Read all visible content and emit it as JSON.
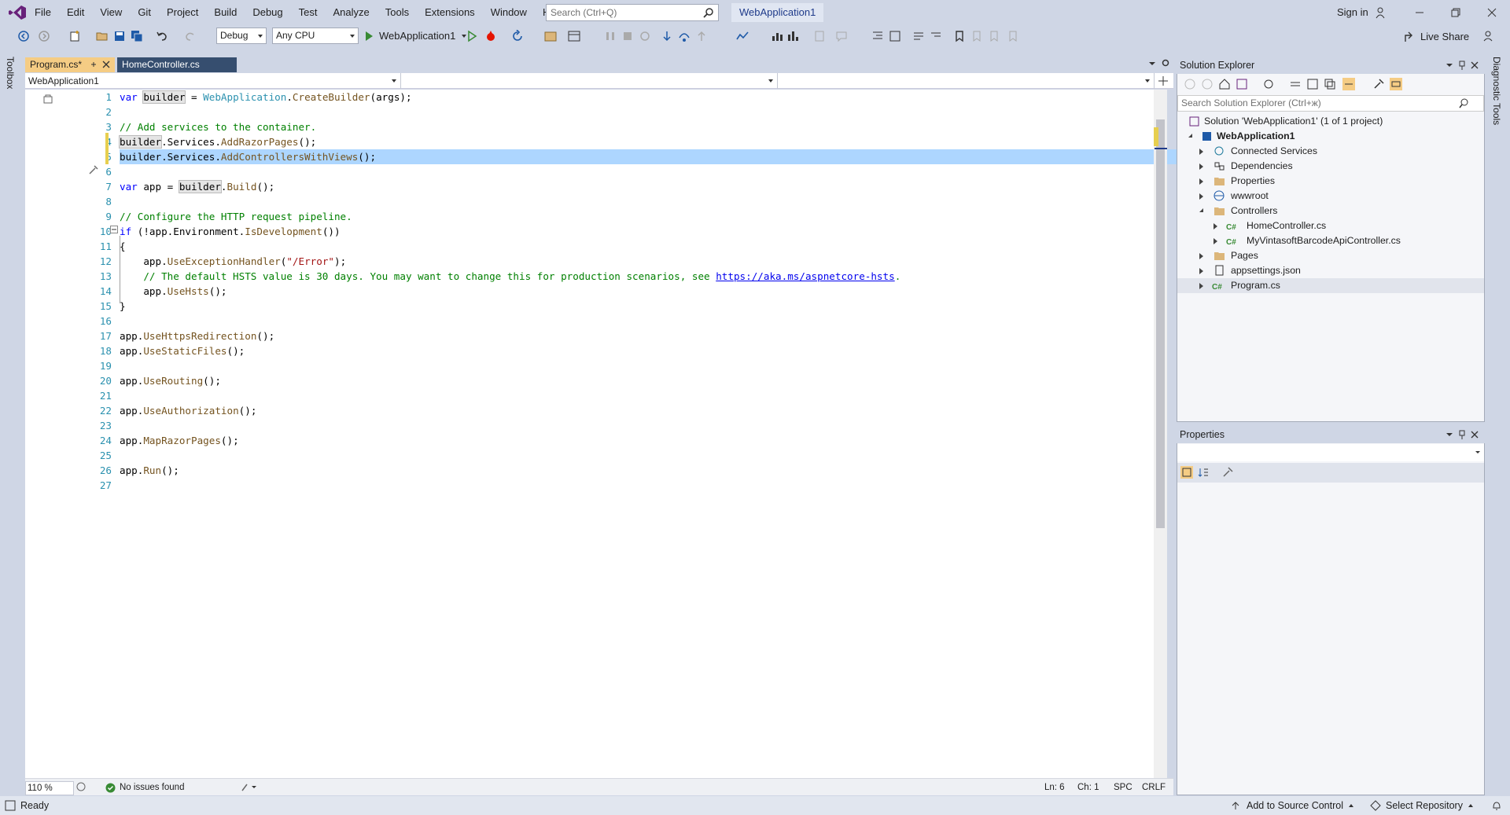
{
  "menu": {
    "items": [
      "File",
      "Edit",
      "View",
      "Git",
      "Project",
      "Build",
      "Debug",
      "Test",
      "Analyze",
      "Tools",
      "Extensions",
      "Window",
      "Help"
    ],
    "search_placeholder": "Search (Ctrl+Q)",
    "solution_name": "WebApplication1",
    "sign_in": "Sign in"
  },
  "toolbar": {
    "config": "Debug",
    "platform": "Any CPU",
    "run_target": "WebApplication1",
    "live_share": "Live Share"
  },
  "left_rail": {
    "toolbox": "Toolbox"
  },
  "right_rail": {
    "diagnostic_tools": "Diagnostic Tools"
  },
  "tabs": [
    {
      "label": "Program.cs*",
      "active": true
    },
    {
      "label": "HomeController.cs",
      "active": false
    }
  ],
  "navbar": {
    "project": "WebApplication1",
    "type": "",
    "member": ""
  },
  "code_lines": [
    "1",
    "2",
    "3",
    "4",
    "5",
    "6",
    "7",
    "8",
    "9",
    "10",
    "11",
    "12",
    "13",
    "14",
    "15",
    "16",
    "17",
    "18",
    "19",
    "20",
    "21",
    "22",
    "23",
    "24",
    "25",
    "26",
    "27"
  ],
  "code": {
    "l1_a": "var ",
    "l1_b": "builder",
    "l1_c": " = ",
    "l1_d": "WebApplication",
    "l1_e": ".",
    "l1_f": "CreateBuilder",
    "l1_g": "(args);",
    "l3": "// Add services to the container.",
    "l4_a": "builder",
    "l4_b": ".Services.",
    "l4_c": "AddRazorPages",
    "l4_d": "();",
    "l5_a": "builder",
    "l5_b": ".Services.",
    "l5_c": "AddControllersWithViews",
    "l5_d": "();",
    "l7_a": "var ",
    "l7_b": "app = ",
    "l7_c": "builder",
    "l7_d": ".",
    "l7_e": "Build",
    "l7_f": "();",
    "l9": "// Configure the HTTP request pipeline.",
    "l10_a": "if",
    "l10_b": " (!app.Environment.",
    "l10_c": "IsDevelopment",
    "l10_d": "())",
    "l11": "{",
    "l12_a": "    app.",
    "l12_b": "UseExceptionHandler",
    "l12_c": "(",
    "l12_d": "\"/Error\"",
    "l12_e": ");",
    "l13_a": "    // The default HSTS value is 30 days. You may want to change this for production scenarios, see ",
    "l13_b": "https://aka.ms/aspnetcore-hsts",
    "l13_c": ".",
    "l14_a": "    app.",
    "l14_b": "UseHsts",
    "l14_c": "();",
    "l15": "}",
    "l17_a": "app.",
    "l17_b": "UseHttpsRedirection",
    "l17_c": "();",
    "l18_a": "app.",
    "l18_b": "UseStaticFiles",
    "l18_c": "();",
    "l20_a": "app.",
    "l20_b": "UseRouting",
    "l20_c": "();",
    "l22_a": "app.",
    "l22_b": "UseAuthorization",
    "l22_c": "();",
    "l24_a": "app.",
    "l24_b": "MapRazorPages",
    "l24_c": "();",
    "l26_a": "app.",
    "l26_b": "Run",
    "l26_c": "();"
  },
  "editor_status": {
    "zoom": "110 %",
    "issues": "No issues found",
    "line": "Ln: 6",
    "col": "Ch: 1",
    "spc": "SPC",
    "eol": "CRLF"
  },
  "solution_explorer": {
    "title": "Solution Explorer",
    "search_placeholder": "Search Solution Explorer (Ctrl+ж)",
    "items": {
      "solution": "Solution 'WebApplication1' (1 of 1 project)",
      "project": "WebApplication1",
      "connected": "Connected Services",
      "deps": "Dependencies",
      "props": "Properties",
      "wwwroot": "wwwroot",
      "controllers": "Controllers",
      "home": "HomeController.cs",
      "vintasoft": "MyVintasoftBarcodeApiController.cs",
      "pages": "Pages",
      "appsettings": "appsettings.json",
      "program": "Program.cs"
    }
  },
  "properties": {
    "title": "Properties"
  },
  "statusbar": {
    "ready": "Ready",
    "add_source": "Add to Source Control",
    "select_repo": "Select Repository"
  },
  "colors": {
    "accent": "#68217a",
    "tab_active": "#f5cc84",
    "selection": "#add6ff"
  }
}
